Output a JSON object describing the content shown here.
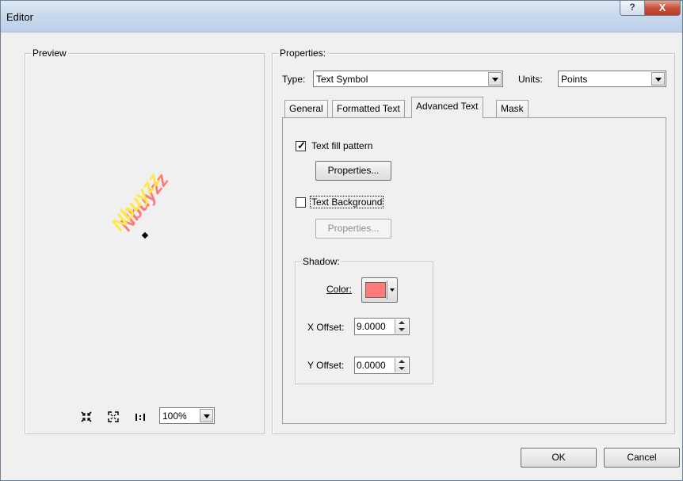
{
  "window": {
    "title": "Editor",
    "help_glyph": "?",
    "close_glyph": "X"
  },
  "preview": {
    "group_label": "Preview",
    "sample_text": "Nbuyzz",
    "zoom": "100%",
    "toolbar": [
      {
        "name": "zoom-in-icon"
      },
      {
        "name": "zoom-out-icon"
      },
      {
        "name": "actual-size-icon"
      }
    ]
  },
  "properties": {
    "group_label": "Properties:",
    "type_label": "Type:",
    "type_value": "Text Symbol",
    "units_label": "Units:",
    "units_value": "Points",
    "tabs": [
      {
        "label": "General",
        "active": false
      },
      {
        "label": "Formatted Text",
        "active": false
      },
      {
        "label": "Advanced Text",
        "active": true
      },
      {
        "label": "Mask",
        "active": false
      }
    ]
  },
  "advanced_text": {
    "text_fill_pattern_label": "Text fill pattern",
    "text_fill_pattern_checked": true,
    "fill_properties_label": "Properties...",
    "text_background_label": "Text Background",
    "text_background_checked": false,
    "background_properties_label": "Properties...",
    "shadow": {
      "group_label": "Shadow:",
      "color_label": "Color:",
      "color": "#ff7a7a",
      "x_offset_label": "X Offset:",
      "x_offset": "9.0000",
      "y_offset_label": "Y Offset:",
      "y_offset": "0.0000"
    }
  },
  "footer": {
    "ok": "OK",
    "cancel": "Cancel"
  },
  "colors": {
    "preview_text": "#ffe84a",
    "preview_shadow": "#ff7a7a"
  }
}
